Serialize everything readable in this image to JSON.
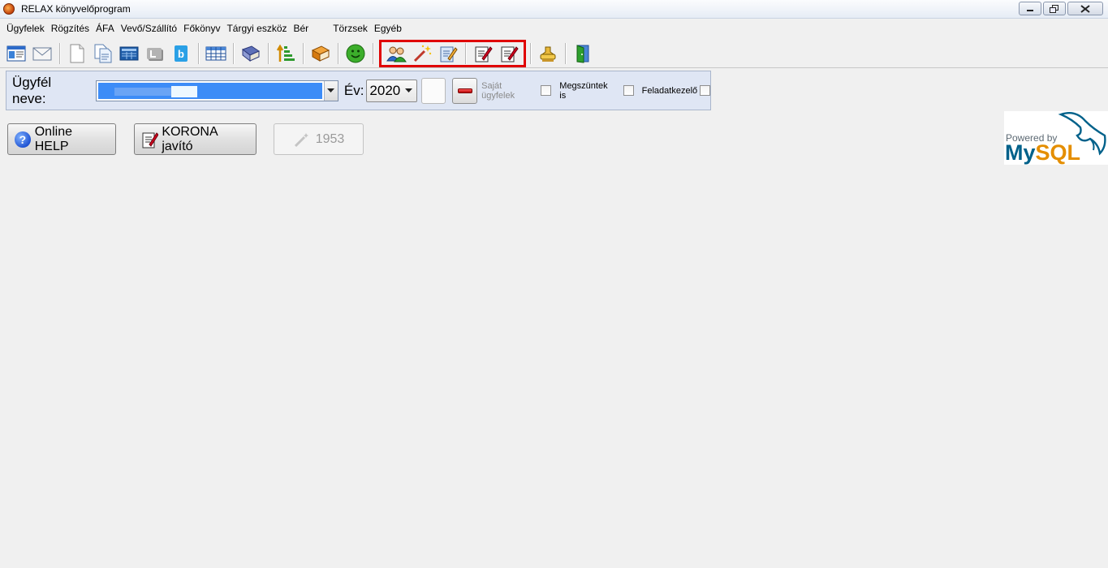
{
  "window": {
    "title": "RELAX könyvelőprogram"
  },
  "menu": [
    "Ügyfelek",
    "Rögzítés",
    "ÁFA",
    "Vevő/Szállító",
    "Főkönyv",
    "Tárgyi eszköz",
    "Bér",
    "Törzsek",
    "Egyéb"
  ],
  "filter": {
    "client_label": "Ügyfél neve:",
    "year_label": "Év:",
    "year_value": "2020",
    "own_clients_label": "Saját ügyfelek",
    "terminated_label": "Megszüntek is",
    "task_manager_label": "Feladatkezelő"
  },
  "buttons": {
    "help": "Online HELP",
    "korona": "KORONA javító",
    "count": "1953"
  },
  "logo": {
    "powered_by": "Powered by",
    "my": "My",
    "sql": "SQL"
  },
  "colors": {
    "highlight": "#e00000",
    "panel": "#dfe6f4",
    "selection": "#3d8cf7"
  }
}
